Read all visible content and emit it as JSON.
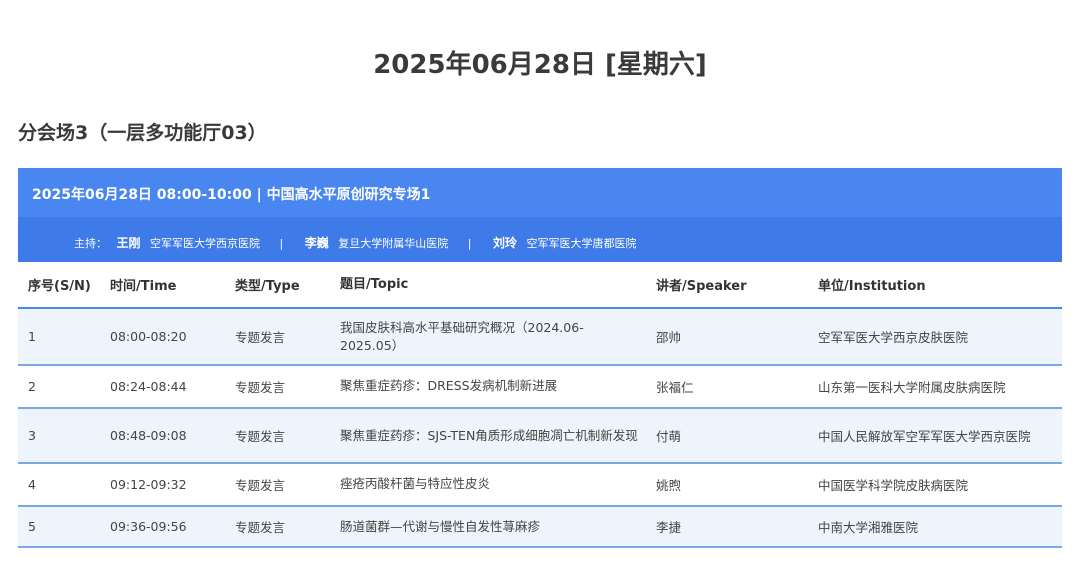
{
  "page_title": "2025年06月28日 [星期六]",
  "venue_title": "分会场3（一层多功能厅03）",
  "session": {
    "header": "2025年06月28日 08:00-10:00 | 中国高水平原创研究专场1",
    "chairs_label": "主持：",
    "separator": "|",
    "chairs": [
      {
        "name": "王刚",
        "org": "空军军医大学西京医院"
      },
      {
        "name": "李巍",
        "org": "复旦大学附属华山医院"
      },
      {
        "name": "刘玲",
        "org": "空军军医大学唐都医院"
      }
    ]
  },
  "table": {
    "headers": [
      "序号(S/N)",
      "时间/Time",
      "类型/Type",
      "题目/Topic",
      "讲者/Speaker",
      "单位/Institution"
    ],
    "rows": [
      {
        "sn": "1",
        "time": "08:00-08:20",
        "type": "专题发言",
        "topic": "我国皮肤科高水平基础研究概况（2024.06-2025.05）",
        "speaker": "邵帅",
        "institution": "空军军医大学西京皮肤医院"
      },
      {
        "sn": "2",
        "time": "08:24-08:44",
        "type": "专题发言",
        "topic": "聚焦重症药疹：DRESS发病机制新进展",
        "speaker": "张福仁",
        "institution": "山东第一医科大学附属皮肤病医院"
      },
      {
        "sn": "3",
        "time": "08:48-09:08",
        "type": "专题发言",
        "topic": "聚焦重症药疹：SJS-TEN角质形成细胞凋亡机制新发现",
        "speaker": "付萌",
        "institution": "中国人民解放军空军军医大学西京医院"
      },
      {
        "sn": "4",
        "time": "09:12-09:32",
        "type": "专题发言",
        "topic": "痤疮丙酸杆菌与特应性皮炎",
        "speaker": "姚煦",
        "institution": "中国医学科学院皮肤病医院"
      },
      {
        "sn": "5",
        "time": "09:36-09:56",
        "type": "专题发言",
        "topic": "肠道菌群—代谢与慢性自发性荨麻疹",
        "speaker": "李捷",
        "institution": "中南大学湘雅医院"
      }
    ]
  }
}
